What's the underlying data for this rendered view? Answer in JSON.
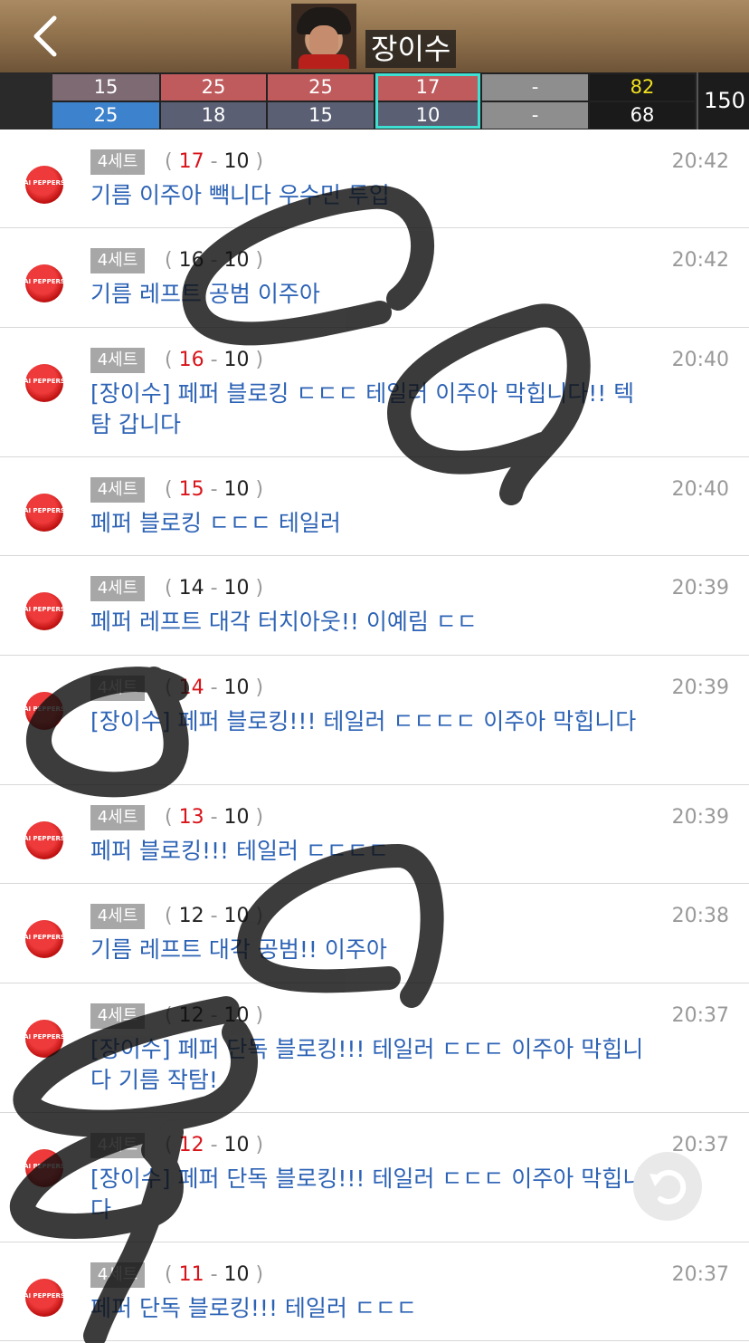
{
  "header": {
    "player_name": "장이수"
  },
  "scoreboard": {
    "home_sets": [
      "15",
      "25",
      "25",
      "17",
      "-"
    ],
    "away_sets": [
      "25",
      "18",
      "15",
      "10",
      "-"
    ],
    "home_total": "82",
    "away_total": "68",
    "grand_total": "150"
  },
  "feed": [
    {
      "set": "4세트",
      "home": "17",
      "away": "10",
      "home_red": true,
      "time": "20:42",
      "text": "기름 이주아 빽니다 우수민 투입"
    },
    {
      "set": "4세트",
      "home": "16",
      "away": "10",
      "home_red": false,
      "time": "20:42",
      "text": "기름 레프트 공범 이주아"
    },
    {
      "set": "4세트",
      "home": "16",
      "away": "10",
      "home_red": true,
      "time": "20:40",
      "text": "[장이수] 페퍼 블로킹 ㄷㄷㄷ 테일러  이주아 막힙니다!! 텍탐 갑니다"
    },
    {
      "set": "4세트",
      "home": "15",
      "away": "10",
      "home_red": true,
      "time": "20:40",
      "text": "페퍼 블로킹 ㄷㄷㄷ 테일러"
    },
    {
      "set": "4세트",
      "home": "14",
      "away": "10",
      "home_red": false,
      "time": "20:39",
      "text": "페퍼 레프트 대각 터치아웃!! 이예림 ㄷㄷ"
    },
    {
      "set": "4세트",
      "home": "14",
      "away": "10",
      "home_red": true,
      "time": "20:39",
      "text": "[장이수] 페퍼 블로킹!!! 테일러 ㄷㄷㄷㄷ 이주아 막힙니다"
    },
    {
      "set": "4세트",
      "home": "13",
      "away": "10",
      "home_red": true,
      "time": "20:39",
      "text": "페퍼 블로킹!!! 테일러 ㄷㄷㄷㄷ"
    },
    {
      "set": "4세트",
      "home": "12",
      "away": "10",
      "home_red": false,
      "time": "20:38",
      "text": "기름 레프트 대각 공범!! 이주아"
    },
    {
      "set": "4세트",
      "home": "12",
      "away": "10",
      "home_red": false,
      "time": "20:37",
      "text": "[장이수] 페퍼 단독 블로킹!!! 테일러 ㄷㄷㄷ 이주아 막힙니다    기름 작탐!"
    },
    {
      "set": "4세트",
      "home": "12",
      "away": "10",
      "home_red": true,
      "time": "20:37",
      "text": "[장이수] 페퍼 단독 블로킹!!! 테일러 ㄷㄷㄷ 이주아 막힙니다"
    },
    {
      "set": "4세트",
      "home": "11",
      "away": "10",
      "home_red": true,
      "time": "20:37",
      "text": "페퍼 단독 블로킹!!! 테일러 ㄷㄷㄷ"
    }
  ],
  "team_logo_text": "AI PEPPERS",
  "icons": {
    "back": "chevron-left-icon",
    "refresh": "refresh-icon"
  }
}
